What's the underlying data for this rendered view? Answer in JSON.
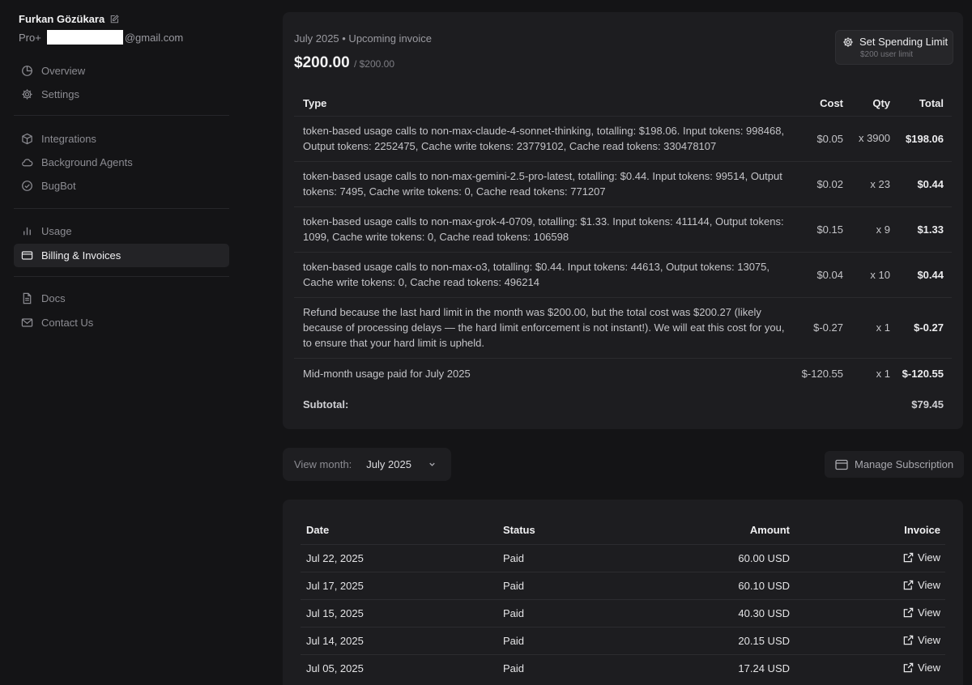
{
  "user": {
    "name": "Furkan Gözükara",
    "plan": "Pro+",
    "email_domain": "@gmail.com"
  },
  "nav": {
    "group1": [
      {
        "label": "Overview",
        "icon": "pie-chart-icon"
      },
      {
        "label": "Settings",
        "icon": "gear-icon"
      }
    ],
    "group2": [
      {
        "label": "Integrations",
        "icon": "cube-icon"
      },
      {
        "label": "Background Agents",
        "icon": "cloud-icon"
      },
      {
        "label": "BugBot",
        "icon": "check-circle-icon"
      }
    ],
    "group3": [
      {
        "label": "Usage",
        "icon": "bar-chart-icon"
      },
      {
        "label": "Billing & Invoices",
        "icon": "credit-card-icon",
        "active": true
      }
    ],
    "group4": [
      {
        "label": "Docs",
        "icon": "document-icon"
      },
      {
        "label": "Contact Us",
        "icon": "mail-icon"
      }
    ]
  },
  "invoice": {
    "period": "July 2025 • Upcoming invoice",
    "amount": "$200.00",
    "limit": "/ $200.00",
    "spend_button": {
      "label": "Set Spending Limit",
      "sub": "$200 user limit"
    },
    "columns": {
      "type": "Type",
      "cost": "Cost",
      "qty": "Qty",
      "total": "Total"
    },
    "rows": [
      {
        "type": "token-based usage calls to non-max-claude-4-sonnet-thinking, totalling: $198.06. Input tokens: 998468, Output tokens: 2252475, Cache write tokens: 23779102, Cache read tokens: 330478107",
        "cost": "$0.05",
        "qty": "x 3900",
        "total": "$198.06"
      },
      {
        "type": "token-based usage calls to non-max-gemini-2.5-pro-latest, totalling: $0.44. Input tokens: 99514, Output tokens: 7495, Cache write tokens: 0, Cache read tokens: 771207",
        "cost": "$0.02",
        "qty": "x 23",
        "total": "$0.44"
      },
      {
        "type": "token-based usage calls to non-max-grok-4-0709, totalling: $1.33. Input tokens: 411144, Output tokens: 1099, Cache write tokens: 0, Cache read tokens: 106598",
        "cost": "$0.15",
        "qty": "x 9",
        "total": "$1.33"
      },
      {
        "type": "token-based usage calls to non-max-o3, totalling: $0.44. Input tokens: 44613, Output tokens: 13075, Cache write tokens: 0, Cache read tokens: 496214",
        "cost": "$0.04",
        "qty": "x 10",
        "total": "$0.44"
      },
      {
        "type": "Refund because the last hard limit in the month was $200.00, but the total cost was $200.27 (likely because of processing delays — the hard limit enforcement is not instant!). We will eat this cost for you, to ensure that your hard limit is upheld.",
        "cost": "$-0.27",
        "qty": "x 1",
        "total": "$-0.27"
      },
      {
        "type": "Mid-month usage paid for July 2025",
        "cost": "$-120.55",
        "qty": "x 1",
        "total": "$-120.55"
      }
    ],
    "subtotal_label": "Subtotal:",
    "subtotal_value": "$79.45"
  },
  "month_picker": {
    "label": "View month:",
    "value": "July 2025"
  },
  "manage_button": {
    "label": "Manage Subscription"
  },
  "history": {
    "columns": {
      "date": "Date",
      "status": "Status",
      "amount": "Amount",
      "invoice": "Invoice"
    },
    "rows": [
      {
        "date": "Jul 22, 2025",
        "status": "Paid",
        "amount": "60.00 USD",
        "link": "View"
      },
      {
        "date": "Jul 17, 2025",
        "status": "Paid",
        "amount": "60.10 USD",
        "link": "View"
      },
      {
        "date": "Jul 15, 2025",
        "status": "Paid",
        "amount": "40.30 USD",
        "link": "View"
      },
      {
        "date": "Jul 14, 2025",
        "status": "Paid",
        "amount": "20.15 USD",
        "link": "View"
      },
      {
        "date": "Jul 05, 2025",
        "status": "Paid",
        "amount": "17.24 USD",
        "link": "View"
      }
    ]
  }
}
